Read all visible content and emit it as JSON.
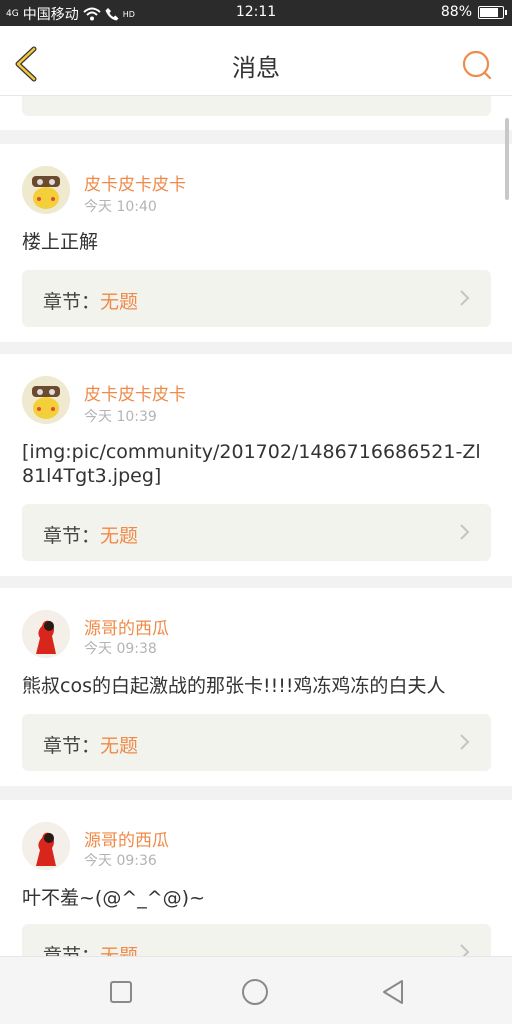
{
  "status_bar": {
    "signal": "4G",
    "carrier": "中国移动",
    "hd": "HD",
    "time": "12:11",
    "battery_text": "88%",
    "battery_level": 0.88
  },
  "header": {
    "title": "消息",
    "back_icon": "chevron-left-icon",
    "search_icon": "search-icon",
    "accent_color": "#ef8a48"
  },
  "chapter_label": "章节：",
  "messages": [
    {
      "author": "皮卡皮卡皮卡",
      "time": "今天 10:40",
      "text": "楼上正解",
      "chapter": "无题"
    },
    {
      "author": "皮卡皮卡皮卡",
      "time": "今天 10:39",
      "text": "[img:pic/community/201702/1486716686521-Zl81l4Tgt3.jpeg]",
      "chapter": "无题"
    },
    {
      "author": "源哥的西瓜",
      "time": "今天 09:38",
      "text": "熊叔cos的白起激战的那张卡!!!!鸡冻鸡冻的白夫人",
      "chapter": "无题"
    },
    {
      "author": "源哥的西瓜",
      "time": "今天 09:36",
      "text": "叶不羞~(@^_^@)~",
      "chapter": "无题"
    }
  ],
  "nav_bar": {
    "recents_icon": "square-icon",
    "home_icon": "circle-icon",
    "back_icon": "triangle-back-icon"
  }
}
